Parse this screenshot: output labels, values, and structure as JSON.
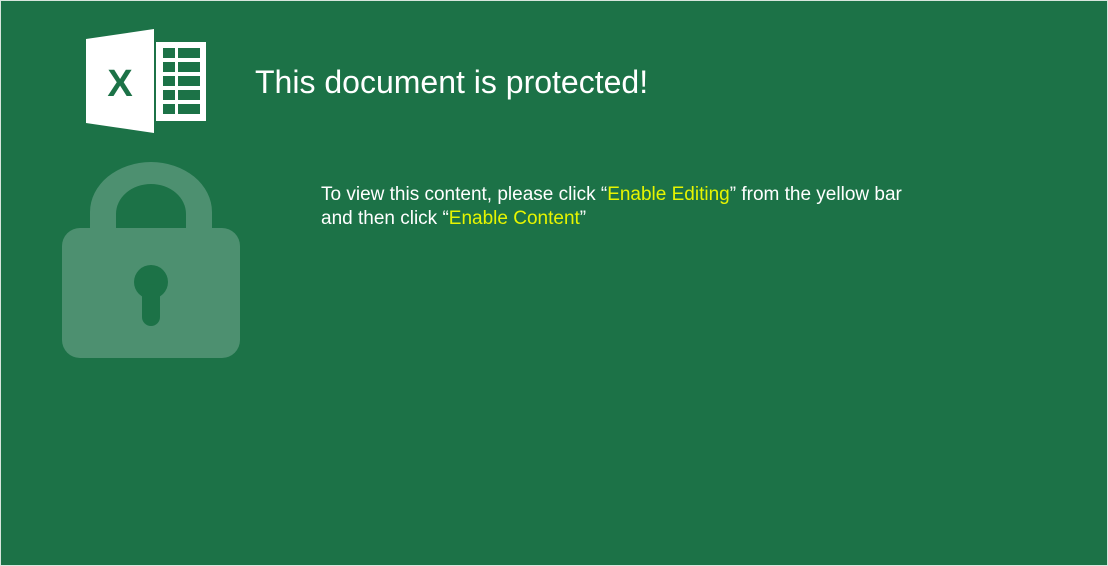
{
  "title": "This document is protected!",
  "message": {
    "line1_prefix": "To view this content, please click “",
    "line1_highlight": "Enable Editing",
    "line1_suffix": "” from the yellow bar",
    "line2_prefix": "and then click “",
    "line2_highlight": "Enable Content",
    "line2_suffix": "”"
  },
  "icons": {
    "logo": "excel-logo-icon",
    "lock": "lock-icon"
  },
  "colors": {
    "background": "#1c7247",
    "highlight": "#e6f500"
  },
  "logo_letter": "X"
}
